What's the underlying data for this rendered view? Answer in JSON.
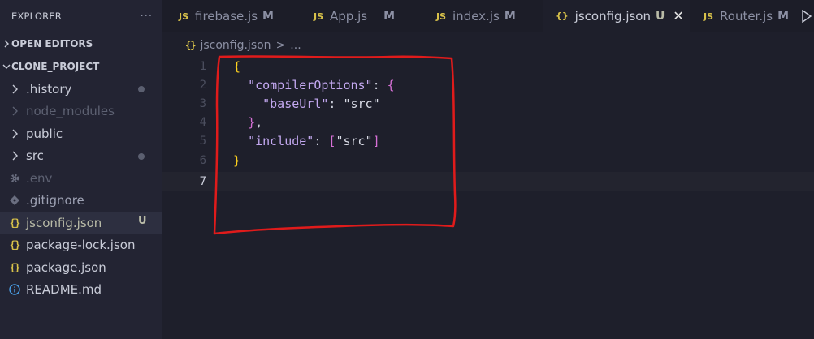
{
  "sidebar": {
    "title": "EXPLORER",
    "more": "···",
    "sections": [
      {
        "label": "OPEN EDITORS"
      },
      {
        "label": "CLONE_PROJECT"
      }
    ],
    "items": [
      {
        "label": ".history",
        "status": "dot"
      },
      {
        "label": "node_modules"
      },
      {
        "label": "public"
      },
      {
        "label": "src",
        "status": "dot"
      },
      {
        "label": ".env"
      },
      {
        "label": ".gitignore"
      },
      {
        "label": "jsconfig.json",
        "badge": "U"
      },
      {
        "label": "package-lock.json"
      },
      {
        "label": "package.json"
      },
      {
        "label": "README.md"
      }
    ]
  },
  "tabs": [
    {
      "icon": "JS",
      "label": "firebase.js",
      "status": "M"
    },
    {
      "icon": "JS",
      "label": "App.js",
      "status": "M"
    },
    {
      "icon": "JS",
      "label": "index.js",
      "status": "M"
    },
    {
      "icon": "{}",
      "label": "jsconfig.json",
      "status": "U",
      "close": "✕"
    },
    {
      "icon": "JS",
      "label": "Router.js",
      "status": "M"
    }
  ],
  "breadcrumb": {
    "icon": "{}",
    "file": "jsconfig.json",
    "sep": ">",
    "more": "..."
  },
  "editor": {
    "line_numbers": [
      "1",
      "2",
      "3",
      "4",
      "5",
      "6",
      "7"
    ],
    "lines": [
      {
        "t1": "{"
      },
      {
        "t1": "\"compilerOptions\"",
        "t2": ":",
        "t3": "{"
      },
      {
        "t1": "\"baseUrl\"",
        "t2": ":",
        "t3": "\"src\""
      },
      {
        "t1": "}",
        "t2": ","
      },
      {
        "t1": "\"include\"",
        "t2": ":",
        "t3": "[",
        "t4": "\"src\"",
        "t5": "]"
      },
      {
        "t1": "}"
      },
      {
        "t1": ""
      }
    ]
  },
  "colors": {
    "accent_highlight": "#e01b1b",
    "json_icon": "#d8c24a",
    "js_icon": "#d8c24a"
  }
}
